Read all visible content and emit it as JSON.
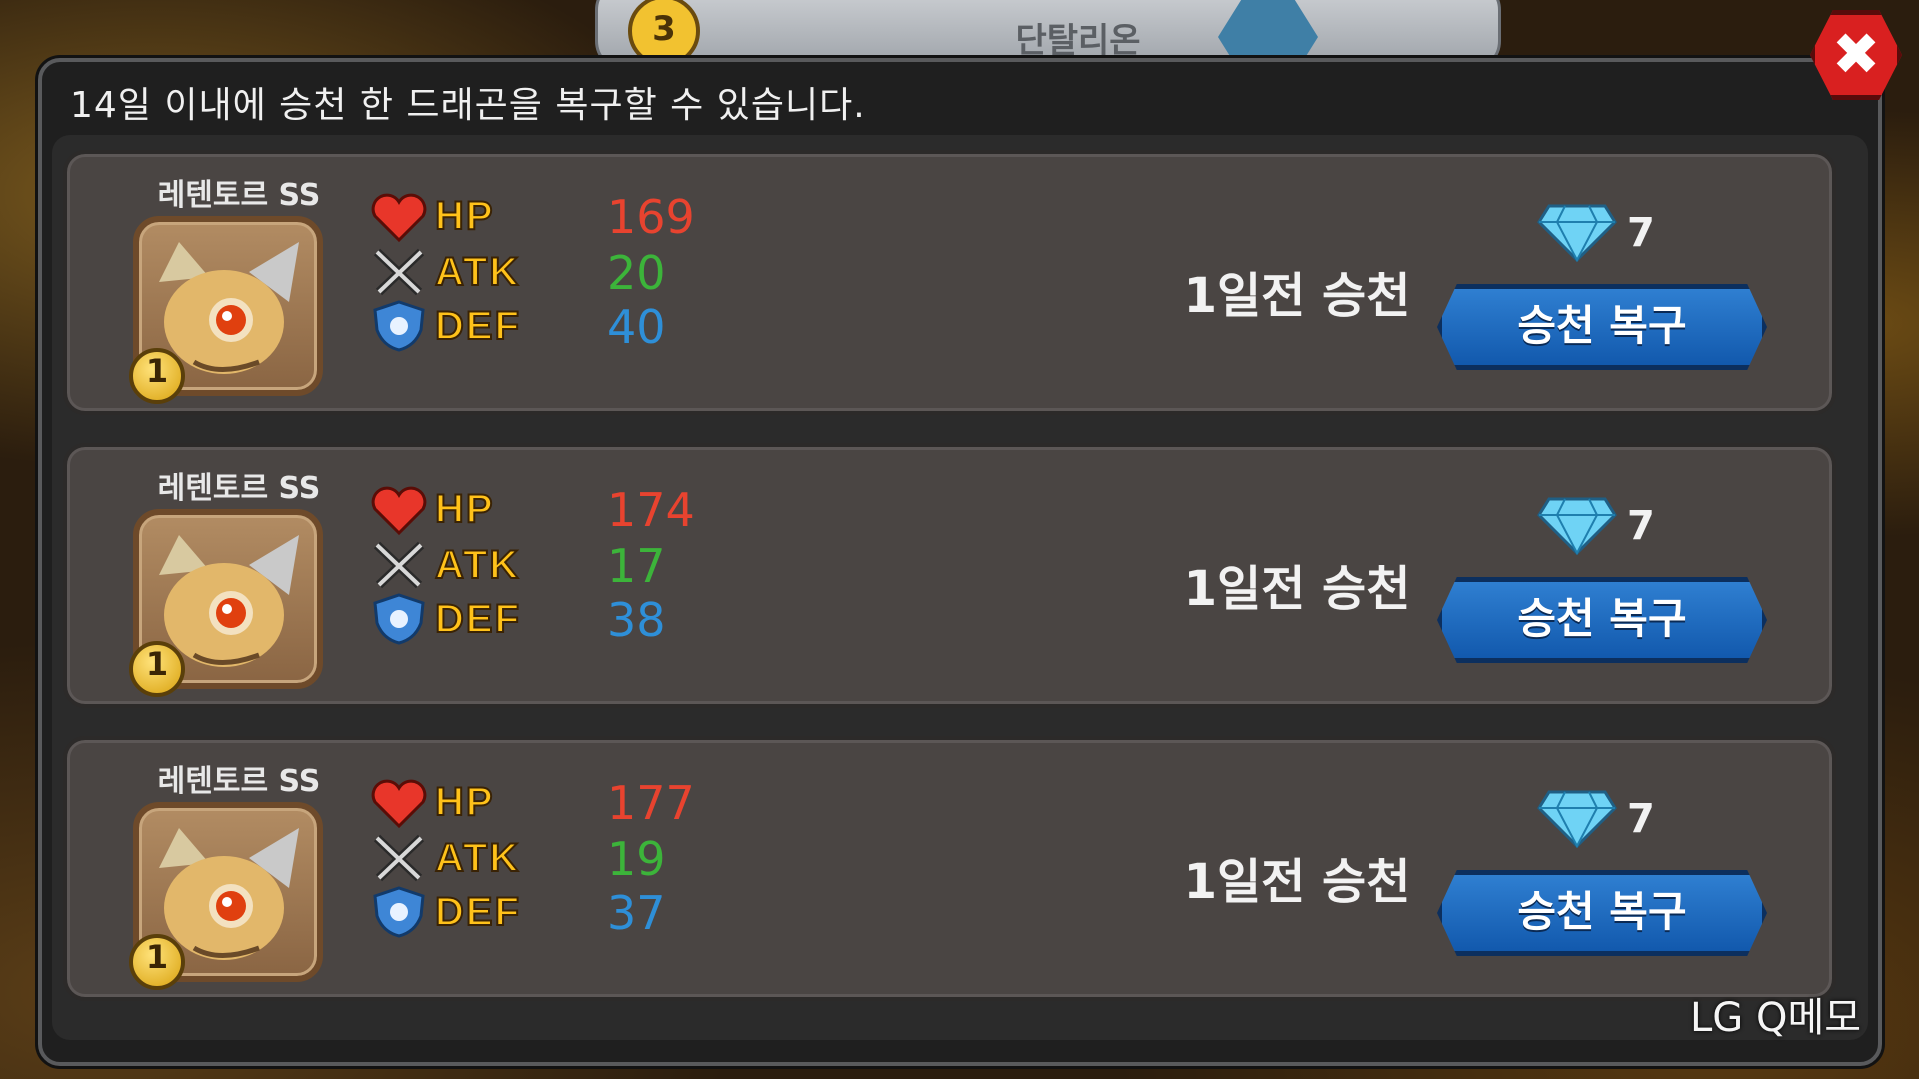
{
  "top_tab": {
    "rank": "3",
    "name": "단탈리온"
  },
  "notice": "14일 이내에 승천 한 드래곤을 복구할 수 있습니다.",
  "dragons": [
    {
      "name": "레텐토르 SS",
      "level": "1",
      "hp_label": "HP",
      "hp": "169",
      "atk_label": "ATK",
      "atk": "20",
      "def_label": "DEF",
      "def": "40",
      "ascend_time": "1일전 승천",
      "gem_cost": "7",
      "button_label": "승천 복구"
    },
    {
      "name": "레텐토르 SS",
      "level": "1",
      "hp_label": "HP",
      "hp": "174",
      "atk_label": "ATK",
      "atk": "17",
      "def_label": "DEF",
      "def": "38",
      "ascend_time": "1일전 승천",
      "gem_cost": "7",
      "button_label": "승천 복구"
    },
    {
      "name": "레텐토르 SS",
      "level": "1",
      "hp_label": "HP",
      "hp": "177",
      "atk_label": "ATK",
      "atk": "19",
      "def_label": "DEF",
      "def": "37",
      "ascend_time": "1일전 승천",
      "gem_cost": "7",
      "button_label": "승천 복구"
    }
  ],
  "close_icon": "close-icon",
  "watermark": "LG Q메모",
  "colors": {
    "hp": "#e8432f",
    "atk": "#3cb43a",
    "def": "#2e8fd8",
    "button": "#1f6cc0",
    "close": "#d92020"
  }
}
